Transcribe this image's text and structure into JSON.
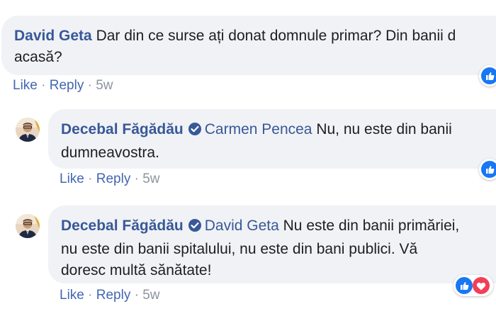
{
  "colors": {
    "name_blue": "#385898",
    "link_blue": "#4267b2",
    "bubble_bg": "#f0f2f5",
    "meta_gray": "#8d949e",
    "like_blue": "#1877f2",
    "love_red": "#f33e58"
  },
  "comments": [
    {
      "author": "David Geta",
      "text": "Dar din ce surse ați donat domnule primar? Din banii d",
      "text_line2": "acasă?",
      "actions": {
        "like": "Like",
        "reply": "Reply",
        "time": "5w"
      },
      "reactions": [
        "like-icon"
      ]
    },
    {
      "author": "Decebal Făgădău",
      "verified": true,
      "mention": "Carmen Pencea",
      "text": "Nu, nu este din banii",
      "text_line2": "dumneavostra.",
      "actions": {
        "like": "Like",
        "reply": "Reply",
        "time": "5w"
      },
      "reactions": [
        "like-icon"
      ]
    },
    {
      "author": "Decebal Făgădău",
      "verified": true,
      "mention": "David Geta",
      "text": "Nu este din banii primăriei,",
      "text_line2": "nu este din banii spitalului, nu este din bani publici. Vă",
      "text_line3": "doresc multă sănătate!",
      "actions": {
        "like": "Like",
        "reply": "Reply",
        "time": "5w"
      },
      "reactions": [
        "like-icon",
        "love-icon"
      ]
    }
  ]
}
